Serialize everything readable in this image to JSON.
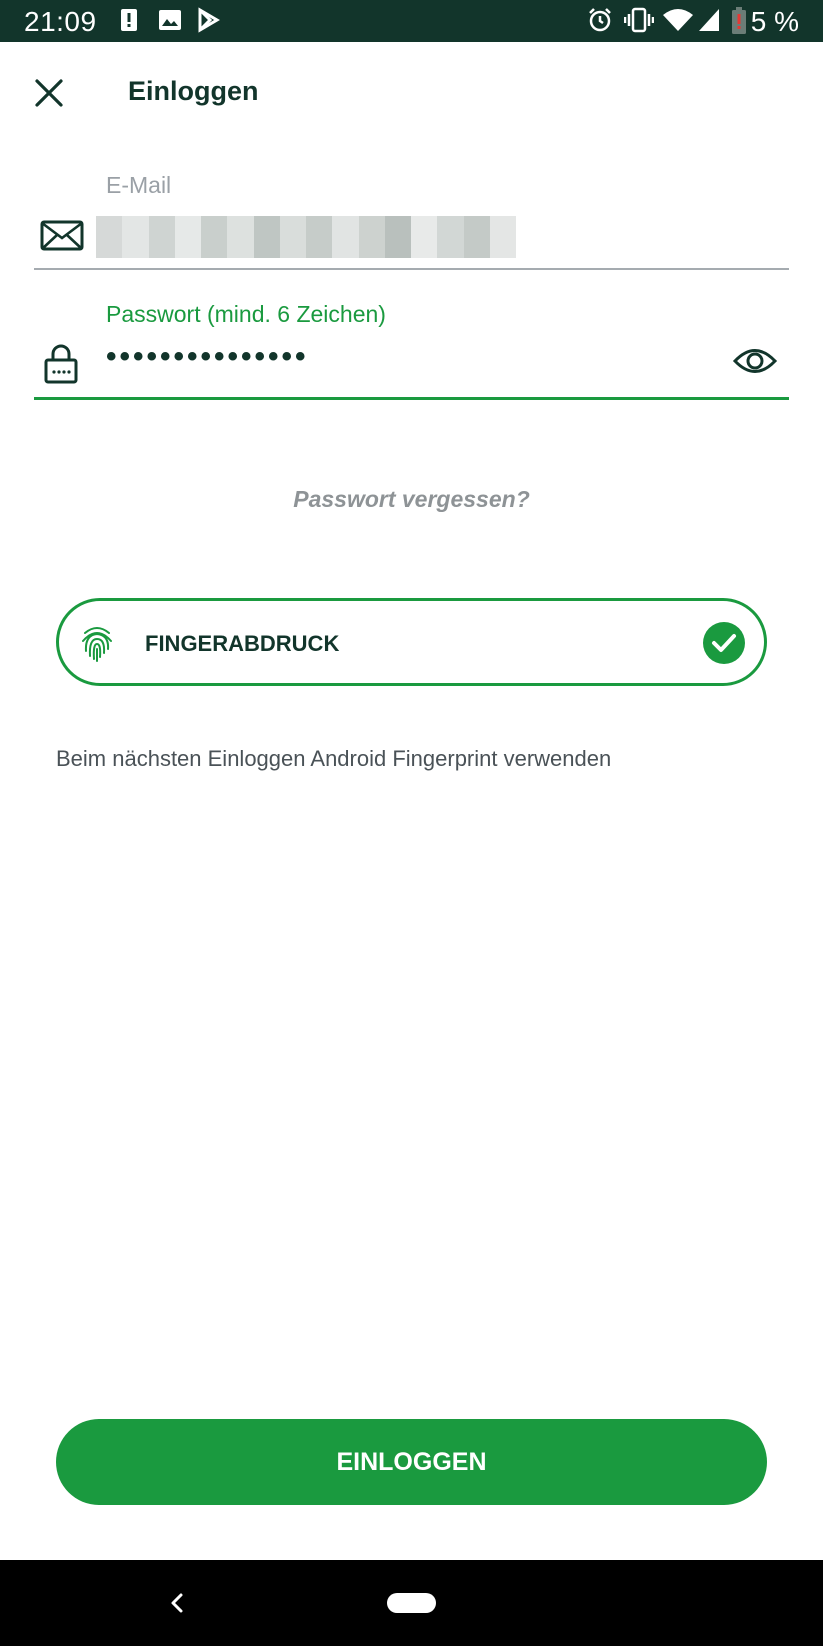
{
  "status_bar": {
    "time": "21:09",
    "battery_percent": "5 %",
    "icons": [
      "alert-icon",
      "image-icon",
      "play-store-icon",
      "alarm-icon",
      "vibrate-icon",
      "wifi-icon",
      "signal-icon",
      "battery-icon"
    ]
  },
  "header": {
    "title": "Einloggen",
    "close_icon": "close-icon"
  },
  "form": {
    "email": {
      "label": "E-Mail",
      "icon": "mail-icon",
      "value_state": "pixelated"
    },
    "password": {
      "label": "Passwort (mind. 6 Zeichen)",
      "icon": "lock-icon",
      "value": "•••••••••••••••",
      "visibility_icon": "eye-icon"
    },
    "forgot_password": "Passwort vergessen?"
  },
  "fingerprint": {
    "label": "FINGERABDRUCK",
    "enabled": true,
    "hint": "Beim nächsten Einloggen Android Fingerprint verwenden"
  },
  "actions": {
    "login_label": "EINLOGGEN"
  },
  "colors": {
    "brand_dark": "#12352b",
    "accent_green": "#1a9a3f",
    "muted_gray": "#9aa0a6"
  }
}
